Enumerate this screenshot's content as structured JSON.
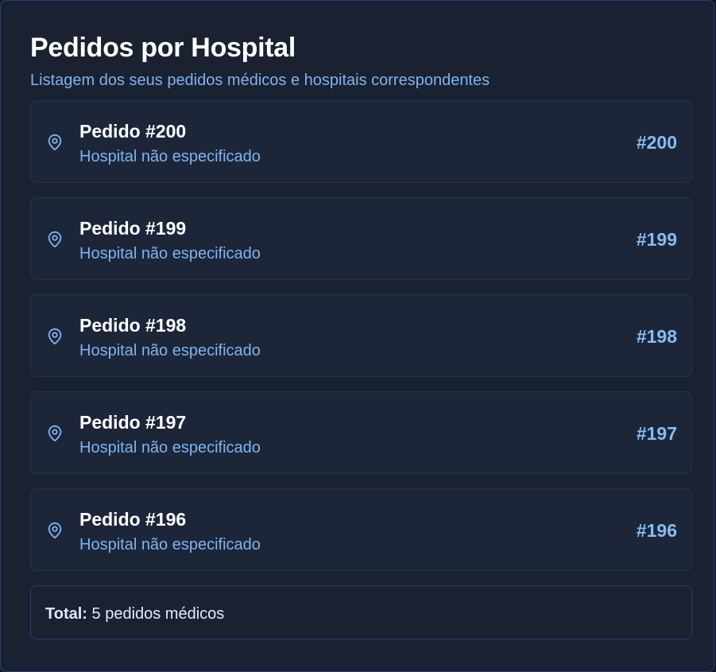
{
  "header": {
    "title": "Pedidos por Hospital",
    "subtitle": "Listagem dos seus pedidos médicos e hospitais correspondentes"
  },
  "orders": [
    {
      "title": "Pedido #200",
      "hospital": "Hospital não especificado",
      "code": "#200"
    },
    {
      "title": "Pedido #199",
      "hospital": "Hospital não especificado",
      "code": "#199"
    },
    {
      "title": "Pedido #198",
      "hospital": "Hospital não especificado",
      "code": "#198"
    },
    {
      "title": "Pedido #197",
      "hospital": "Hospital não especificado",
      "code": "#197"
    },
    {
      "title": "Pedido #196",
      "hospital": "Hospital não especificado",
      "code": "#196"
    }
  ],
  "footer": {
    "total_label": "Total:",
    "total_value": "5 pedidos médicos"
  },
  "icons": {
    "order_icon": "map-pin-icon"
  },
  "colors": {
    "background": "#1a2130",
    "item_background": "#1d2638",
    "accent_text": "#7db4f0",
    "code_text": "#86bdf5",
    "border": "#2b3e78"
  }
}
